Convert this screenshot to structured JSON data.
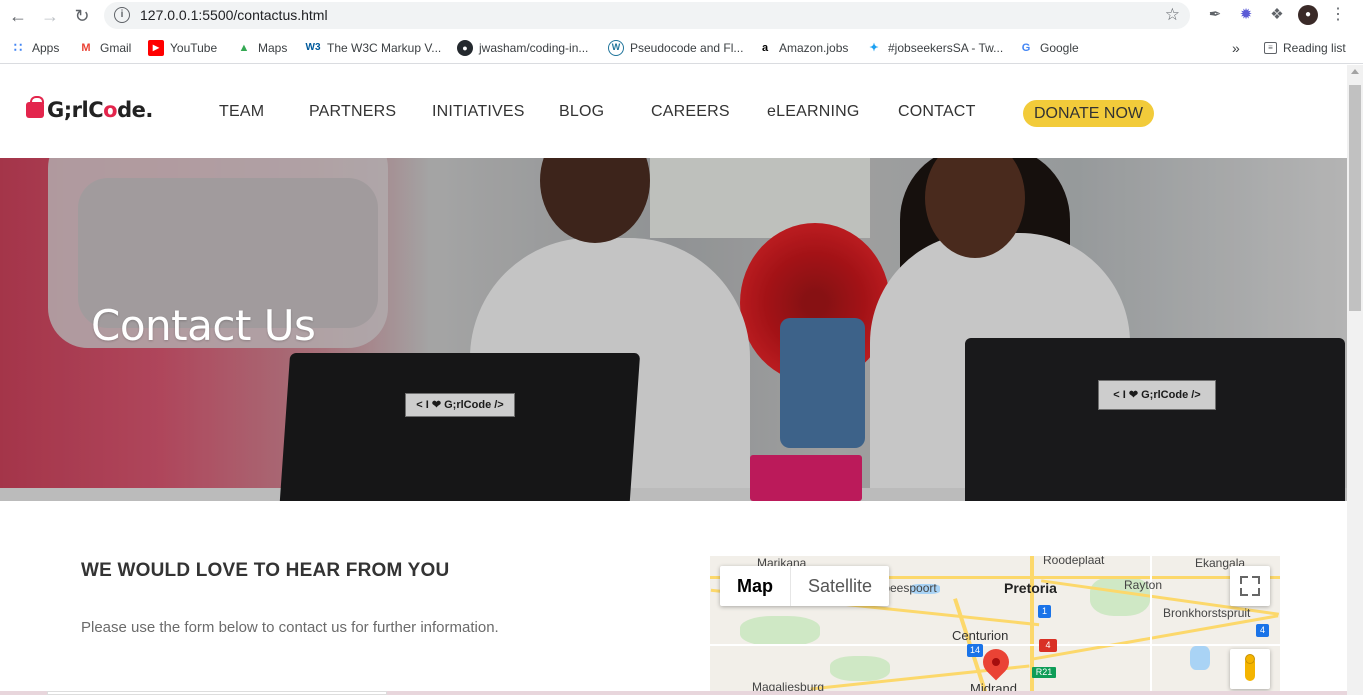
{
  "browser": {
    "url": "127.0.0.1:5500/contactus.html",
    "bookmarks": [
      {
        "label": "Apps",
        "icon": "apps-grid-icon",
        "color": "#4285f4"
      },
      {
        "label": "Gmail",
        "icon": "gmail-icon",
        "color": "#ea4335"
      },
      {
        "label": "YouTube",
        "icon": "youtube-icon",
        "color": "#ff0000"
      },
      {
        "label": "Maps",
        "icon": "maps-icon",
        "color": "#34a853"
      },
      {
        "label": "The W3C Markup V...",
        "icon": "w3c-icon",
        "color": "#005a9c"
      },
      {
        "label": "jwasham/coding-in...",
        "icon": "github-icon",
        "color": "#24292e"
      },
      {
        "label": "Pseudocode and Fl...",
        "icon": "wordpress-icon",
        "color": "#21759b"
      },
      {
        "label": "Amazon.jobs",
        "icon": "amazon-icon",
        "color": "#000000"
      },
      {
        "label": "#jobseekersSA - Tw...",
        "icon": "twitter-icon",
        "color": "#1da1f2"
      },
      {
        "label": "Google",
        "icon": "google-icon",
        "color": "#4285f4"
      }
    ],
    "overflow_label": "»",
    "reading_list_label": "Reading list"
  },
  "site": {
    "logo_text_a": "G",
    "logo_text_b": ";rlC",
    "logo_text_c": "o",
    "logo_text_d": "de.",
    "nav": [
      "TEAM",
      "PARTNERS",
      "INITIATIVES",
      "BLOG",
      "CAREERS",
      "eLEARNING",
      "CONTACT"
    ],
    "donate_label": "DONATE NOW",
    "accent_color": "#f2cb3a",
    "brand_color": "#e3254c"
  },
  "hero": {
    "title": "Contact Us",
    "sticker_left": "< I ❤ G;rlCode />",
    "sticker_right": "< I ❤ G;rlCode />"
  },
  "contact": {
    "heading": "WE WOULD LOVE TO HEAR FROM YOU",
    "subtext": "Please use the form below to contact us for further information."
  },
  "map": {
    "map_label": "Map",
    "satellite_label": "Satellite",
    "places": {
      "marikana": "Marikana",
      "roodeplaat": "Roodeplaat",
      "ekangala": "Ekangala",
      "atteridgeville": "rtbeespoort",
      "pretoria": "Pretoria",
      "rayton": "Rayton",
      "bronkhorstspruit": "Bronkhorstspruit",
      "centurion": "Centurion",
      "magaliesburg": "Magaliesburg",
      "midrand": "Midrand"
    },
    "shields": {
      "n1": "1",
      "n4": "4",
      "n14": "14",
      "r21": "R21",
      "n4b": "4"
    }
  }
}
